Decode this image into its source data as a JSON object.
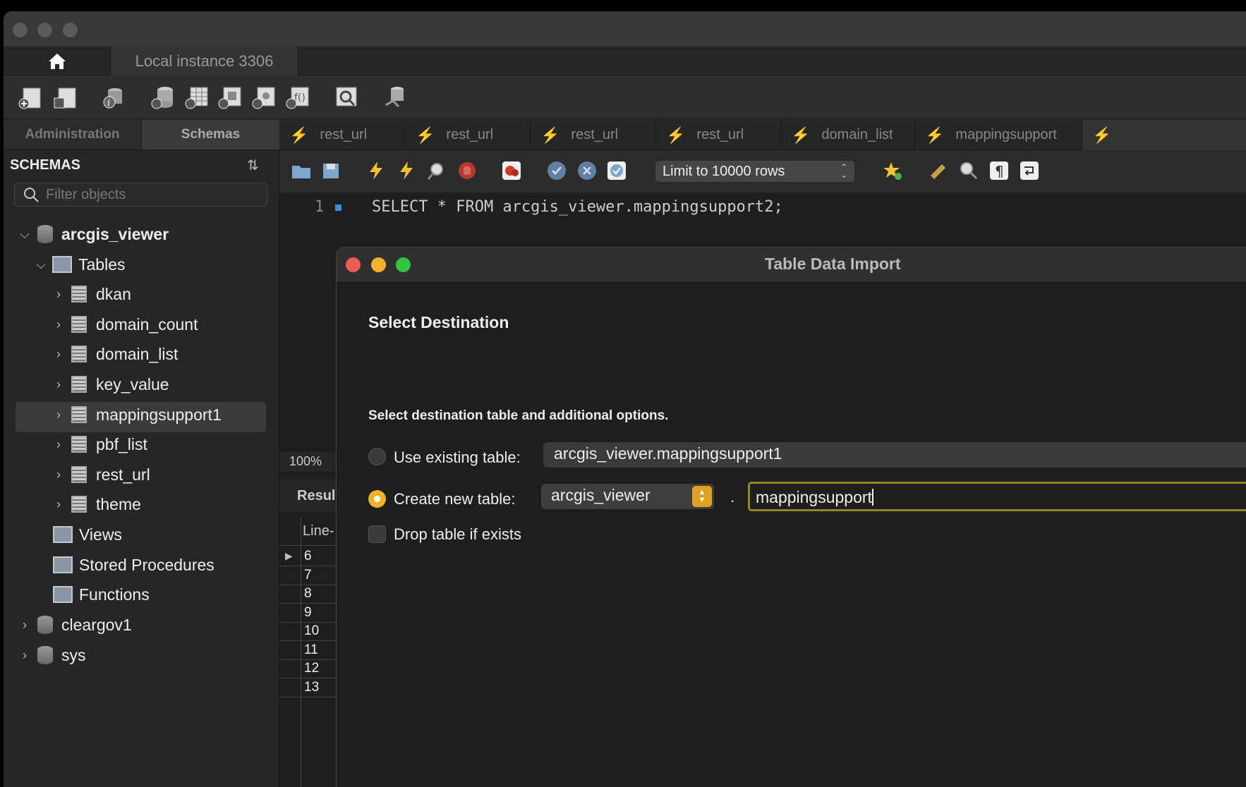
{
  "window": {
    "instance_tab": "Local instance 3306"
  },
  "sidebar": {
    "tabs": [
      "Administration",
      "Schemas"
    ],
    "heading": "SCHEMAS",
    "filter_placeholder": "Filter objects",
    "schemas": [
      {
        "name": "arcgis_viewer",
        "tables_label": "Tables",
        "tables": [
          "dkan",
          "domain_count",
          "domain_list",
          "key_value",
          "mappingsupport1",
          "pbf_list",
          "rest_url",
          "theme"
        ],
        "selected_table": "mappingsupport1",
        "folders": [
          "Views",
          "Stored Procedures",
          "Functions"
        ]
      },
      {
        "name": "cleargov1"
      },
      {
        "name": "sys"
      }
    ]
  },
  "editor_tabs": [
    "rest_url",
    "rest_url",
    "rest_url",
    "rest_url",
    "domain_list",
    "mappingsupport"
  ],
  "editor_toolbar": {
    "limit_label": "Limit to 10000 rows"
  },
  "editor": {
    "line_number": "1",
    "sql": "SELECT * FROM arcgis_viewer.mappingsupport2;"
  },
  "results": {
    "zoom": "100%",
    "tab_label": "Resul",
    "column_header": "Line-",
    "rows": [
      "6",
      "7",
      "8",
      "9",
      "10",
      "11",
      "12",
      "13"
    ]
  },
  "dialog": {
    "title": "Table Data Import",
    "heading": "Select Destination",
    "subheading": "Select destination table and additional options.",
    "use_existing_label": "Use existing table:",
    "use_existing_value": "arcgis_viewer.mappingsupport1",
    "create_new_label": "Create new table:",
    "schema_select_value": "arcgis_viewer",
    "separator": ".",
    "new_table_name": "mappingsupport",
    "drop_table_label": "Drop table if exists",
    "selected_option": "create_new"
  },
  "colors": {
    "accent_orange": "#f0b22a",
    "focus_ring": "#8d8a2a",
    "close": "#ee5b52",
    "minimize": "#f5b22b",
    "zoom": "#30c543"
  }
}
